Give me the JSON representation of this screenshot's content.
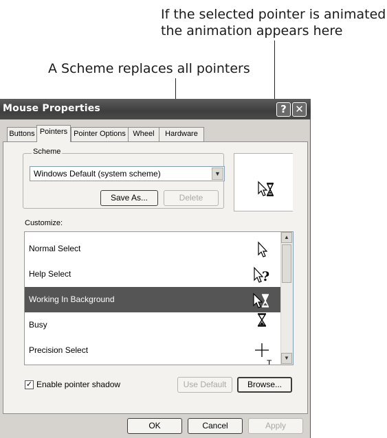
{
  "callouts": {
    "animated_line1": "If the selected pointer is animated",
    "animated_line2": "the animation appears here",
    "scheme": "A Scheme replaces all pointers"
  },
  "window": {
    "title": "Mouse Properties",
    "help_button": "?",
    "close_button": "✕"
  },
  "tabs": [
    {
      "label": "Buttons"
    },
    {
      "label": "Pointers"
    },
    {
      "label": "Pointer Options"
    },
    {
      "label": "Wheel"
    },
    {
      "label": "Hardware"
    }
  ],
  "active_tab": "Pointers",
  "scheme": {
    "group_label": "Scheme",
    "selected": "Windows Default (system scheme)",
    "save_as": "Save As...",
    "delete": "Delete"
  },
  "customize": {
    "label": "Customize:",
    "items": [
      {
        "label": "Normal Select",
        "icon": "arrow-pointer-icon"
      },
      {
        "label": "Help Select",
        "icon": "help-pointer-icon"
      },
      {
        "label": "Working In Background",
        "icon": "working-pointer-icon",
        "selected": true
      },
      {
        "label": "Busy",
        "icon": "hourglass-icon"
      },
      {
        "label": "Precision Select",
        "icon": "crosshair-icon"
      }
    ]
  },
  "shadow": {
    "label": "Enable pointer shadow",
    "checked": true
  },
  "buttons": {
    "use_default": "Use Default",
    "browse": "Browse...",
    "ok": "OK",
    "cancel": "Cancel",
    "apply": "Apply"
  }
}
